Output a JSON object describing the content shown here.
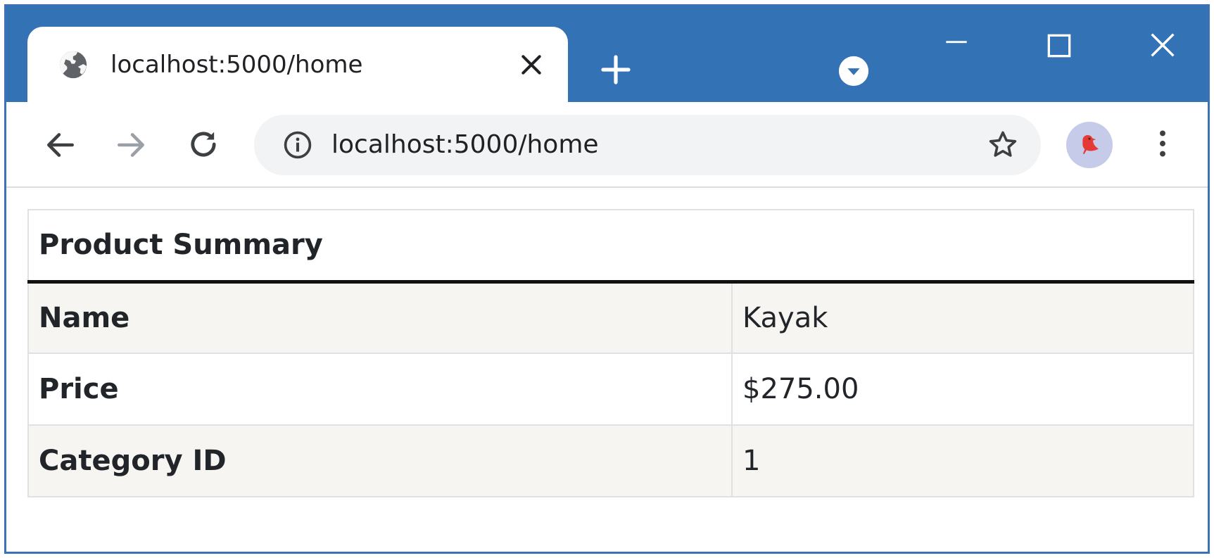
{
  "browser": {
    "tab": {
      "title": "localhost:5000/home"
    },
    "address_bar": {
      "url": "localhost:5000/home"
    },
    "colors": {
      "titlebar": "#3373b5",
      "omnibox": "#f1f3f4",
      "avatar_bg": "#c5cbe9",
      "avatar_bird": "#e53935"
    }
  },
  "page": {
    "table": {
      "heading": "Product Summary",
      "rows": [
        {
          "label": "Name",
          "value": "Kayak"
        },
        {
          "label": "Price",
          "value": "$275.00"
        },
        {
          "label": "Category ID",
          "value": "1"
        }
      ]
    }
  }
}
